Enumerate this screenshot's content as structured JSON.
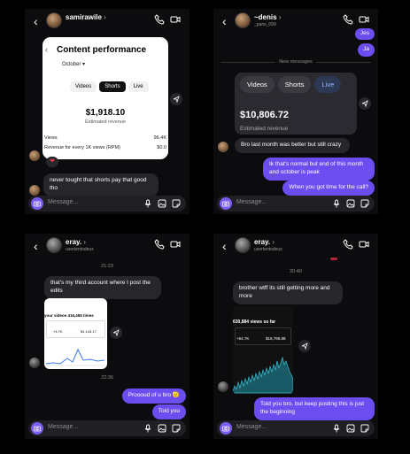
{
  "panels": {
    "p1": {
      "username": "samirawile",
      "card": {
        "title": "Content performance",
        "month": "October",
        "tabs": [
          "Videos",
          "Shorts",
          "Live"
        ],
        "selected_tab": "Shorts",
        "amount": "$1,918.10",
        "amount_label": "Estimated revenue",
        "rows": [
          {
            "label": "Views",
            "value": "96.4K"
          },
          {
            "label": "Revenue for every 1K views (RPM)",
            "value": "$0.0"
          }
        ]
      },
      "reaction": "❤",
      "messages": [
        {
          "dir": "in",
          "text": "never tought that shorts pay that good tho"
        }
      ],
      "placeholder": "Message..."
    },
    "p2": {
      "username": "~denis",
      "subtitle": "_paris_099",
      "top_bubbles": [
        "Jes",
        "Ja"
      ],
      "divider": "New messages",
      "card": {
        "tabs": [
          "Videos",
          "Shorts",
          "Live"
        ],
        "selected_tab": "Live",
        "amount": "$10,806.72",
        "amount_label": "Estimated revenue"
      },
      "messages": [
        {
          "dir": "in",
          "text": "Bro last  month was better but still crazy"
        },
        {
          "dir": "out",
          "text": "Ik that's normal but end of this month and october is peak"
        },
        {
          "dir": "out",
          "text": "When you got time for the call?"
        }
      ],
      "placeholder": "Message..."
    },
    "p3": {
      "username": "eray.",
      "subtitle": "usertentodeux",
      "time1": "21:23",
      "time2": "22:36",
      "card": {
        "header": "your videos 416,455 times",
        "stat1": "+4.7K",
        "stat2": "$1,143.17"
      },
      "messages": [
        {
          "dir": "in",
          "text": "that's my third account where I post the edits"
        },
        {
          "dir": "out",
          "text": "Proooud of u bro 🫡"
        },
        {
          "dir": "out",
          "text": "Told you"
        }
      ],
      "placeholder": "Message..."
    },
    "p4": {
      "username": "eray.",
      "subtitle": "usertentodeux",
      "time1": "20:40",
      "card": {
        "header": "630,884 views so far",
        "stat1": "+64.7K",
        "stat2": "$16,796.88"
      },
      "messages": [
        {
          "dir": "in",
          "text": "brother wtff its still getting more and more"
        },
        {
          "dir": "out",
          "text": "Told you bro, but keep posting this is just the beginning"
        }
      ],
      "placeholder": "Message..."
    }
  },
  "colors": {
    "accent": "#6b4df0",
    "incoming": "#26262b",
    "background": "#0c0c0f"
  }
}
